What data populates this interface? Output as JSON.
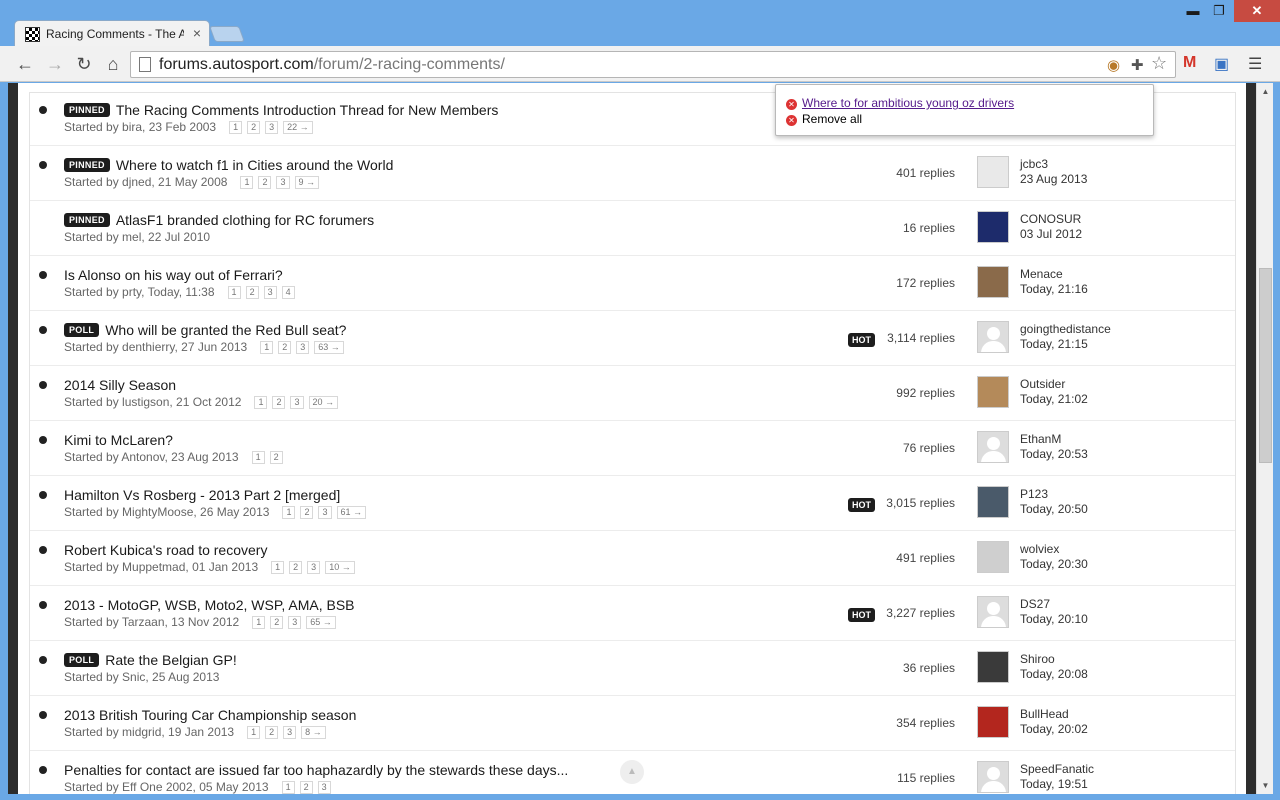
{
  "window": {
    "tab_title": "Racing Comments - The A",
    "minimize": "▬",
    "maximize": "❐",
    "close": "✕"
  },
  "toolbar": {
    "url_host": "forums.autosport.com",
    "url_path": "/forum/2-racing-comments/"
  },
  "popup": {
    "link_text": "Where to for ambitious young oz drivers",
    "remove_all": "Remove all"
  },
  "topics": [
    {
      "badge": "PINNED",
      "title": "The Racing Comments Introduction Thread for New Members",
      "started": "Started by bira, 23 Feb 2003",
      "pages": [
        "1",
        "2",
        "3",
        "22 →"
      ],
      "bullet": true,
      "hot": false,
      "replies": "",
      "last_user": "",
      "last_time": ""
    },
    {
      "badge": "PINNED",
      "title": "Where to watch f1 in Cities around the World",
      "started": "Started by djned, 21 May 2008",
      "pages": [
        "1",
        "2",
        "3",
        "9 →"
      ],
      "bullet": true,
      "hot": false,
      "replies": "401 replies",
      "last_user": "jcbc3",
      "last_time": "23 Aug 2013"
    },
    {
      "badge": "PINNED",
      "title": "AtlasF1 branded clothing for RC forumers",
      "started": "Started by mel, 22 Jul 2010",
      "pages": [],
      "bullet": false,
      "hot": false,
      "replies": "16 replies",
      "last_user": "CONOSUR",
      "last_time": "03 Jul 2012"
    },
    {
      "badge": "",
      "title": "Is Alonso on his way out of Ferrari?",
      "started": "Started by prty, Today, 11:38",
      "pages": [
        "1",
        "2",
        "3",
        "4"
      ],
      "bullet": true,
      "hot": false,
      "replies": "172 replies",
      "last_user": "Menace",
      "last_time": "Today, 21:16"
    },
    {
      "badge": "POLL",
      "title": "Who will be granted the Red Bull seat?",
      "started": "Started by denthierry, 27 Jun 2013",
      "pages": [
        "1",
        "2",
        "3",
        "63 →"
      ],
      "bullet": true,
      "hot": true,
      "replies": "3,114 replies",
      "last_user": "goingthedistance",
      "last_time": "Today, 21:15"
    },
    {
      "badge": "",
      "title": "2014 Silly Season",
      "started": "Started by lustigson, 21 Oct 2012",
      "pages": [
        "1",
        "2",
        "3",
        "20 →"
      ],
      "bullet": true,
      "hot": false,
      "replies": "992 replies",
      "last_user": "Outsider",
      "last_time": "Today, 21:02"
    },
    {
      "badge": "",
      "title": "Kimi to McLaren?",
      "started": "Started by Antonov, 23 Aug 2013",
      "pages": [
        "1",
        "2"
      ],
      "bullet": true,
      "hot": false,
      "replies": "76 replies",
      "last_user": "EthanM",
      "last_time": "Today, 20:53"
    },
    {
      "badge": "",
      "title": "Hamilton Vs Rosberg - 2013 Part 2 [merged]",
      "started": "Started by MightyMoose, 26 May 2013",
      "pages": [
        "1",
        "2",
        "3",
        "61 →"
      ],
      "bullet": true,
      "hot": true,
      "replies": "3,015 replies",
      "last_user": "P123",
      "last_time": "Today, 20:50"
    },
    {
      "badge": "",
      "title": "Robert Kubica's road to recovery",
      "started": "Started by Muppetmad, 01 Jan 2013",
      "pages": [
        "1",
        "2",
        "3",
        "10 →"
      ],
      "bullet": true,
      "hot": false,
      "replies": "491 replies",
      "last_user": "wolviex",
      "last_time": "Today, 20:30"
    },
    {
      "badge": "",
      "title": "2013 - MotoGP, WSB, Moto2, WSP, AMA, BSB",
      "started": "Started by Tarzaan, 13 Nov 2012",
      "pages": [
        "1",
        "2",
        "3",
        "65 →"
      ],
      "bullet": true,
      "hot": true,
      "replies": "3,227 replies",
      "last_user": "DS27",
      "last_time": "Today, 20:10"
    },
    {
      "badge": "POLL",
      "title": "Rate the Belgian GP!",
      "started": "Started by Snic, 25 Aug 2013",
      "pages": [],
      "bullet": true,
      "hot": false,
      "replies": "36 replies",
      "last_user": "Shiroo",
      "last_time": "Today, 20:08"
    },
    {
      "badge": "",
      "title": "2013 British Touring Car Championship season",
      "started": "Started by midgrid, 19 Jan 2013",
      "pages": [
        "1",
        "2",
        "3",
        "8 →"
      ],
      "bullet": true,
      "hot": false,
      "replies": "354 replies",
      "last_user": "BullHead",
      "last_time": "Today, 20:02"
    },
    {
      "badge": "",
      "title": "Penalties for contact are issued far too haphazardly by the stewards these days...",
      "started": "Started by Eff One 2002, 05 May 2013",
      "pages": [
        "1",
        "2",
        "3"
      ],
      "bullet": true,
      "hot": false,
      "replies": "115 replies",
      "last_user": "SpeedFanatic",
      "last_time": "Today, 19:51"
    }
  ],
  "hot_label": "HOT",
  "avatar_colors": [
    "",
    "#e9e9e9",
    "#1d2b6b",
    "#8a6a4a",
    "",
    "#b48a5a",
    "",
    "#4a5a6a",
    "#cfcfcf",
    "",
    "#3a3a3a",
    "#b3261e",
    ""
  ]
}
